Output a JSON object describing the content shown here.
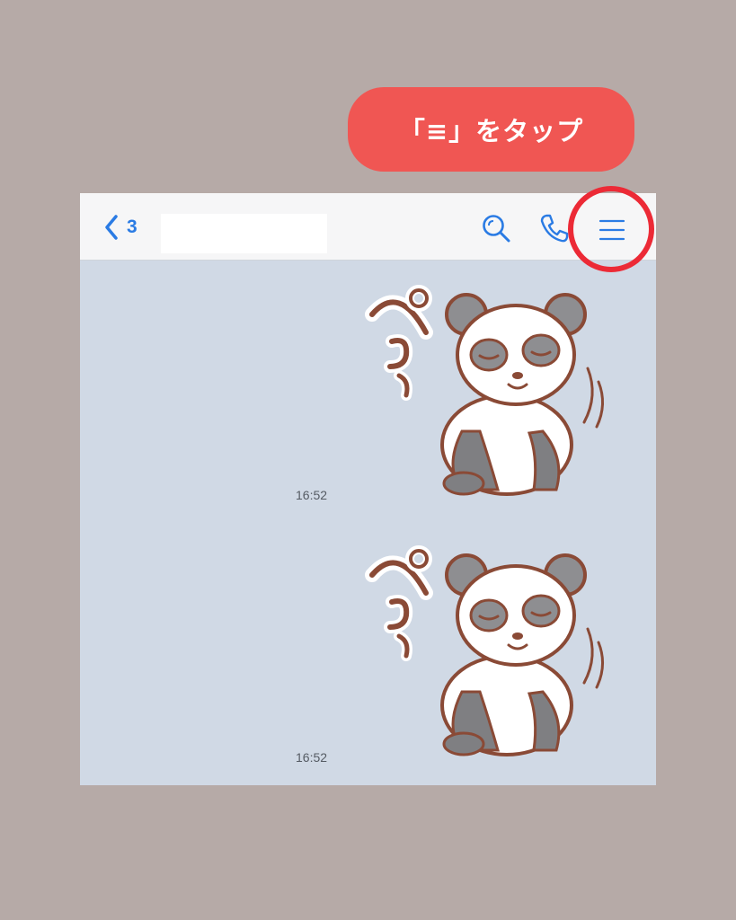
{
  "callout": {
    "text": "「≡」をタップ"
  },
  "header": {
    "back_count": "3",
    "icons": {
      "back": "chevron-left-icon",
      "search": "search-icon",
      "call": "phone-icon",
      "menu": "hamburger-menu-icon"
    }
  },
  "messages": [
    {
      "sticker_text": "ペこっ",
      "time": "16:52"
    },
    {
      "sticker_text": "ペこっ",
      "time": "16:52"
    }
  ],
  "colors": {
    "background": "#b6aaa7",
    "callout": "#f05653",
    "accent": "#2a7be4",
    "highlight_ring": "#ec2a36",
    "chat_background": "#d0d9e5"
  }
}
